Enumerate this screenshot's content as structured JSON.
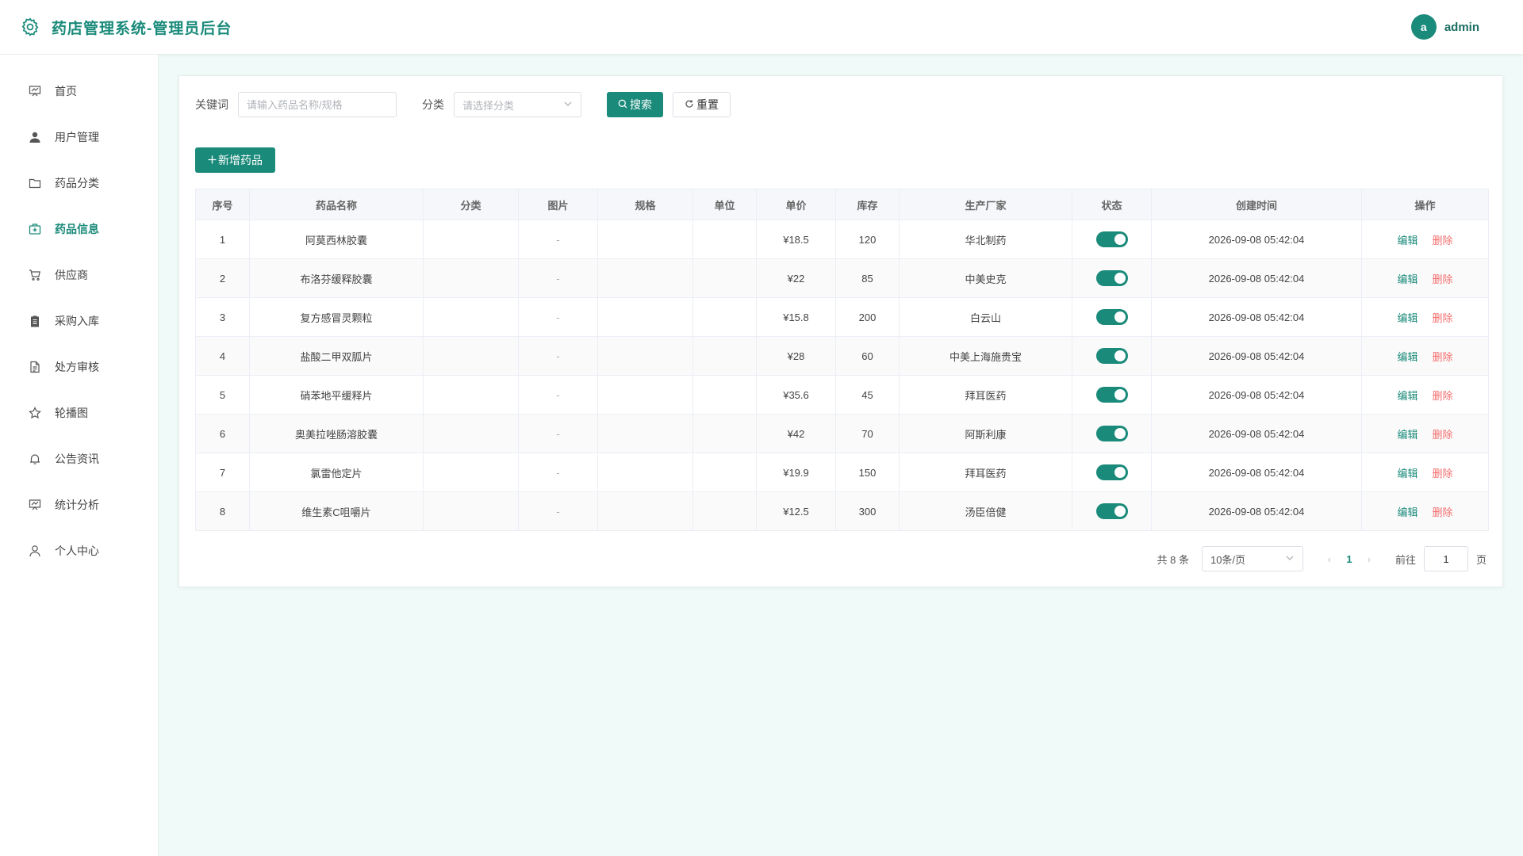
{
  "header": {
    "title": "药店管理系统-管理员后台",
    "avatar_letter": "a",
    "username": "admin"
  },
  "sidebar": {
    "items": [
      {
        "label": "首页",
        "icon": "dashboard-icon",
        "active": false
      },
      {
        "label": "用户管理",
        "icon": "user-icon",
        "active": false
      },
      {
        "label": "药品分类",
        "icon": "folder-icon",
        "active": false
      },
      {
        "label": "药品信息",
        "icon": "medicine-box-icon",
        "active": true
      },
      {
        "label": "供应商",
        "icon": "cart-icon",
        "active": false
      },
      {
        "label": "采购入库",
        "icon": "clipboard-icon",
        "active": false
      },
      {
        "label": "处方审核",
        "icon": "document-icon",
        "active": false
      },
      {
        "label": "轮播图",
        "icon": "star-icon",
        "active": false
      },
      {
        "label": "公告资讯",
        "icon": "bell-icon",
        "active": false
      },
      {
        "label": "统计分析",
        "icon": "chart-board-icon",
        "active": false
      },
      {
        "label": "个人中心",
        "icon": "person-icon",
        "active": false
      }
    ]
  },
  "filters": {
    "keyword_label": "关键词",
    "keyword_placeholder": "请输入药品名称/规格",
    "keyword_value": "",
    "category_label": "分类",
    "category_placeholder": "请选择分类",
    "search_label": "搜索",
    "reset_label": "重置"
  },
  "toolbar": {
    "add_label": "新增药品"
  },
  "table": {
    "columns": [
      "序号",
      "药品名称",
      "分类",
      "图片",
      "规格",
      "单位",
      "单价",
      "库存",
      "生产厂家",
      "状态",
      "创建时间",
      "操作"
    ],
    "rows": [
      {
        "no": "1",
        "name": "阿莫西林胶囊",
        "category": "",
        "image": "-",
        "spec": "",
        "unit": "",
        "price": "¥18.5",
        "stock": "120",
        "maker": "华北制药",
        "status": true,
        "created": "2026-09-08 05:42:04"
      },
      {
        "no": "2",
        "name": "布洛芬缓释胶囊",
        "category": "",
        "image": "-",
        "spec": "",
        "unit": "",
        "price": "¥22",
        "stock": "85",
        "maker": "中美史克",
        "status": true,
        "created": "2026-09-08 05:42:04"
      },
      {
        "no": "3",
        "name": "复方感冒灵颗粒",
        "category": "",
        "image": "-",
        "spec": "",
        "unit": "",
        "price": "¥15.8",
        "stock": "200",
        "maker": "白云山",
        "status": true,
        "created": "2026-09-08 05:42:04"
      },
      {
        "no": "4",
        "name": "盐酸二甲双胍片",
        "category": "",
        "image": "-",
        "spec": "",
        "unit": "",
        "price": "¥28",
        "stock": "60",
        "maker": "中美上海施贵宝",
        "status": true,
        "created": "2026-09-08 05:42:04"
      },
      {
        "no": "5",
        "name": "硝苯地平缓释片",
        "category": "",
        "image": "-",
        "spec": "",
        "unit": "",
        "price": "¥35.6",
        "stock": "45",
        "maker": "拜耳医药",
        "status": true,
        "created": "2026-09-08 05:42:04"
      },
      {
        "no": "6",
        "name": "奥美拉唑肠溶胶囊",
        "category": "",
        "image": "-",
        "spec": "",
        "unit": "",
        "price": "¥42",
        "stock": "70",
        "maker": "阿斯利康",
        "status": true,
        "created": "2026-09-08 05:42:04"
      },
      {
        "no": "7",
        "name": "氯雷他定片",
        "category": "",
        "image": "-",
        "spec": "",
        "unit": "",
        "price": "¥19.9",
        "stock": "150",
        "maker": "拜耳医药",
        "status": true,
        "created": "2026-09-08 05:42:04"
      },
      {
        "no": "8",
        "name": "维生素C咀嚼片",
        "category": "",
        "image": "-",
        "spec": "",
        "unit": "",
        "price": "¥12.5",
        "stock": "300",
        "maker": "汤臣倍健",
        "status": true,
        "created": "2026-09-08 05:42:04"
      }
    ],
    "edit_label": "编辑",
    "delete_label": "删除"
  },
  "pagination": {
    "total_text": "共 8 条",
    "page_size": "10条/页",
    "current_page": "1",
    "goto_label": "前往",
    "goto_value": "1",
    "page_suffix": "页"
  },
  "colors": {
    "accent": "#1a8a7a",
    "danger": "#f56c6c",
    "background": "#f0fbf9"
  }
}
